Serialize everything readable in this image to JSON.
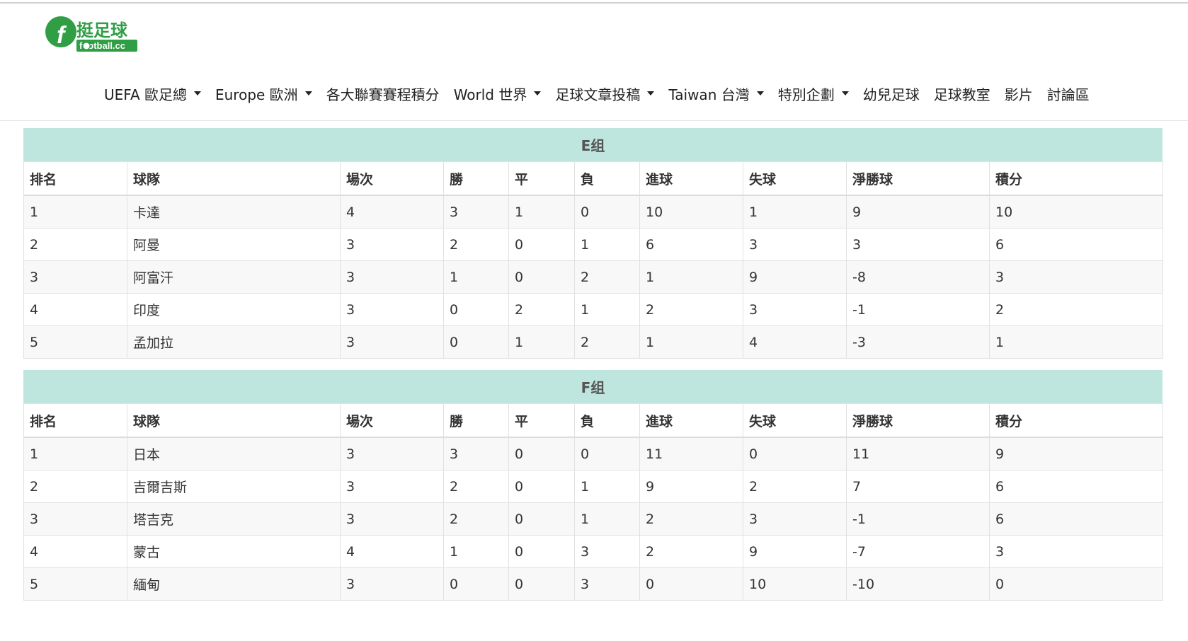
{
  "site": {
    "logo_text": "挺足球",
    "logo_subtext": "football.cc"
  },
  "nav": [
    {
      "label": "UEFA 歐足總",
      "dropdown": true
    },
    {
      "label": "Europe 歐洲",
      "dropdown": true
    },
    {
      "label": "各大聯賽賽程積分",
      "dropdown": false
    },
    {
      "label": "World 世界",
      "dropdown": true
    },
    {
      "label": "足球文章投稿",
      "dropdown": true
    },
    {
      "label": "Taiwan 台灣",
      "dropdown": true
    },
    {
      "label": "特別企劃",
      "dropdown": true
    },
    {
      "label": "幼兒足球",
      "dropdown": false
    },
    {
      "label": "足球教室",
      "dropdown": false
    },
    {
      "label": "影片",
      "dropdown": false
    },
    {
      "label": "討論區",
      "dropdown": false
    }
  ],
  "columns": [
    "排名",
    "球隊",
    "場次",
    "勝",
    "平",
    "負",
    "進球",
    "失球",
    "淨勝球",
    "積分"
  ],
  "groups": [
    {
      "title": "E组",
      "rows": [
        [
          "1",
          "卡達",
          "4",
          "3",
          "1",
          "0",
          "10",
          "1",
          "9",
          "10"
        ],
        [
          "2",
          "阿曼",
          "3",
          "2",
          "0",
          "1",
          "6",
          "3",
          "3",
          "6"
        ],
        [
          "3",
          "阿富汗",
          "3",
          "1",
          "0",
          "2",
          "1",
          "9",
          "-8",
          "3"
        ],
        [
          "4",
          "印度",
          "3",
          "0",
          "2",
          "1",
          "2",
          "3",
          "-1",
          "2"
        ],
        [
          "5",
          "孟加拉",
          "3",
          "0",
          "1",
          "2",
          "1",
          "4",
          "-3",
          "1"
        ]
      ]
    },
    {
      "title": "F组",
      "rows": [
        [
          "1",
          "日本",
          "3",
          "3",
          "0",
          "0",
          "11",
          "0",
          "11",
          "9"
        ],
        [
          "2",
          "吉爾吉斯",
          "3",
          "2",
          "0",
          "1",
          "9",
          "2",
          "7",
          "6"
        ],
        [
          "3",
          "塔吉克",
          "3",
          "2",
          "0",
          "1",
          "2",
          "3",
          "-1",
          "6"
        ],
        [
          "4",
          "蒙古",
          "4",
          "1",
          "0",
          "3",
          "2",
          "9",
          "-7",
          "3"
        ],
        [
          "5",
          "緬甸",
          "3",
          "0",
          "0",
          "3",
          "0",
          "10",
          "-10",
          "0"
        ]
      ]
    }
  ],
  "colors": {
    "group_header_bg": "#bfe6de",
    "logo_green": "#2f9e44"
  }
}
